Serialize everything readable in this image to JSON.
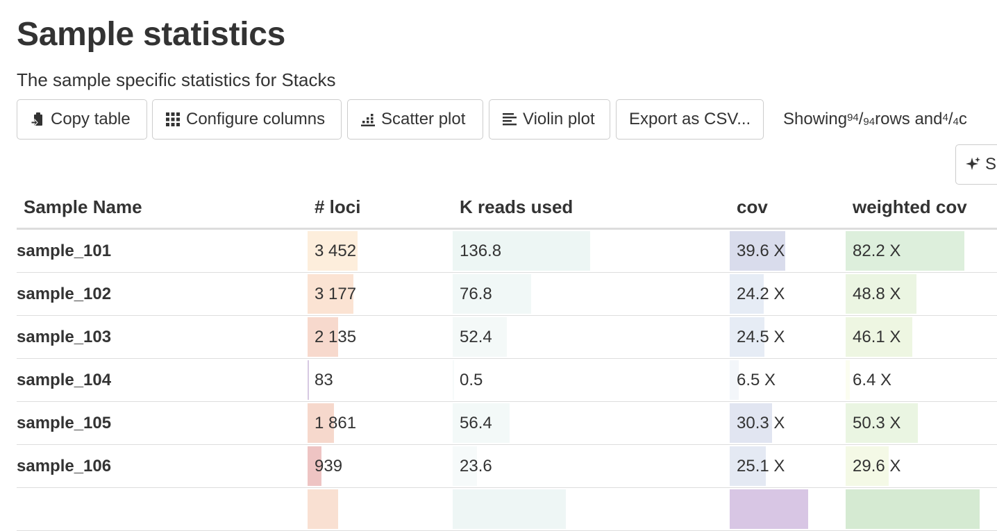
{
  "page": {
    "title": "Sample statistics",
    "subtitle": "The sample specific statistics for Stacks"
  },
  "toolbar": {
    "copy_label": "Copy table",
    "configure_label": "Configure columns",
    "scatter_label": "Scatter plot",
    "violin_label": "Violin plot",
    "export_label": "Export as CSV...",
    "showing_prefix": "Showing ",
    "rows_shown": "94",
    "rows_total": "94",
    "rows_and": " rows and ",
    "cols_shown": "4",
    "cols_total": "4",
    "cols_suffix": " c",
    "ai_label": "S"
  },
  "table": {
    "headers": [
      "Sample Name",
      "# loci",
      "K reads used",
      "cov",
      "weighted cov"
    ],
    "rows": [
      {
        "name": "sample_101",
        "loci": "3 452",
        "kreads": "136.8",
        "cov": "39.6 X",
        "wcov": "82.2 X"
      },
      {
        "name": "sample_102",
        "loci": "3 177",
        "kreads": "76.8",
        "cov": "24.2 X",
        "wcov": "48.8 X"
      },
      {
        "name": "sample_103",
        "loci": "2 135",
        "kreads": "52.4",
        "cov": "24.5 X",
        "wcov": "46.1 X"
      },
      {
        "name": "sample_104",
        "loci": "83",
        "kreads": "0.5",
        "cov": "6.5 X",
        "wcov": "6.4 X"
      },
      {
        "name": "sample_105",
        "loci": "1 861",
        "kreads": "56.4",
        "cov": "30.3 X",
        "wcov": "50.3 X"
      },
      {
        "name": "sample_106",
        "loci": "939",
        "kreads": "23.6",
        "cov": "25.1 X",
        "wcov": "29.6 X"
      },
      {
        "name": "",
        "loci": "",
        "kreads": "",
        "cov": "",
        "wcov": ""
      }
    ],
    "bar_fraction": {
      "loci": [
        0.36,
        0.33,
        0.22,
        0.009,
        0.19,
        0.1,
        0.22
      ],
      "kreads": [
        0.51,
        0.29,
        0.2,
        0.002,
        0.21,
        0.09,
        0.42
      ],
      "cov": [
        0.51,
        0.31,
        0.32,
        0.08,
        0.39,
        0.33,
        0.72
      ],
      "wcov": [
        0.82,
        0.49,
        0.46,
        0.03,
        0.5,
        0.3,
        0.93
      ]
    },
    "bar_colors": {
      "loci": [
        "#fdeedc",
        "#fbe3d3",
        "#f7d9cd",
        "#d7c9e2",
        "#f6d8cc",
        "#eec4c3",
        "#f9e0d2"
      ],
      "kreads": [
        "#edf6f4",
        "#f1f8f7",
        "#f4f9f8",
        "#f6fafa",
        "#f3f9f8",
        "#f6fafa",
        "#eef6f5"
      ],
      "cov": [
        "#d9dcec",
        "#e6ecf5",
        "#e6ecf5",
        "#f3f6fa",
        "#e1e5f1",
        "#e4e9f3",
        "#d8c6e4"
      ],
      "wcov": [
        "#ddefdc",
        "#ebf5e2",
        "#eef6e2",
        "#fbfdf0",
        "#eaf5e2",
        "#f4f9e6",
        "#d5ead2"
      ]
    }
  }
}
